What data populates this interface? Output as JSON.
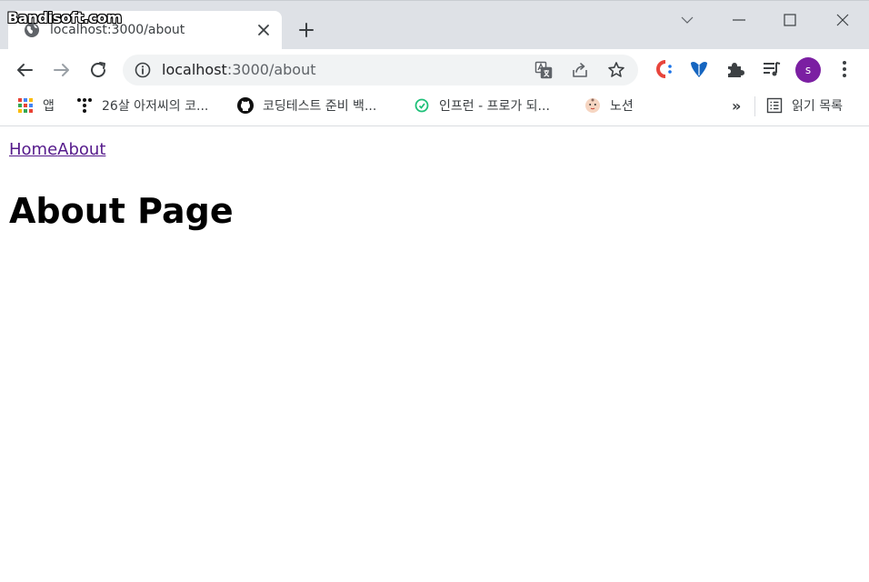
{
  "watermark": "Bandisoft.com",
  "colors": {
    "tabstrip_bg": "#dee1e6",
    "omnibox_bg": "#f1f3f4",
    "avatar_bg": "#7b1fa2",
    "visited_link": "#551a8b"
  },
  "tab": {
    "title": "localhost:3000/about",
    "favicon": "globe-icon",
    "close_icon": "close-icon"
  },
  "tabstrip": {
    "new_tab_icon": "plus-icon",
    "window_controls": [
      "chevron-down-icon",
      "minimize-icon",
      "maximize-icon",
      "close-icon"
    ]
  },
  "toolbar": {
    "back_icon": "arrow-left-icon",
    "forward_icon": "arrow-right-icon",
    "reload_icon": "reload-icon",
    "url_host": "localhost",
    "url_path": ":3000/about",
    "omnibox_icons": [
      "translate-icon",
      "share-icon",
      "star-icon"
    ],
    "extension_icons": [
      "c-extension-icon",
      "heart-extension-icon",
      "puzzle-icon",
      "media-queue-icon"
    ],
    "avatar_letter": "s",
    "menu_icon": "kebab-menu-icon"
  },
  "bookmarks": {
    "items": [
      {
        "icon": "apps-grid-icon",
        "label": "앱"
      },
      {
        "icon": "dots-logo-icon",
        "label": "26살 아저씨의 코..."
      },
      {
        "icon": "github-icon",
        "label": "코딩테스트 준비 백..."
      },
      {
        "icon": "inflearn-icon",
        "label": "인프런 - 프로가 되..."
      },
      {
        "icon": "notion-icon",
        "label": "노션"
      }
    ],
    "overflow": "»",
    "reading_list": {
      "icon": "reading-list-icon",
      "label": "읽기 목록"
    }
  },
  "page": {
    "nav": [
      {
        "label": "Home"
      },
      {
        "label": "About"
      }
    ],
    "heading": "About Page"
  }
}
